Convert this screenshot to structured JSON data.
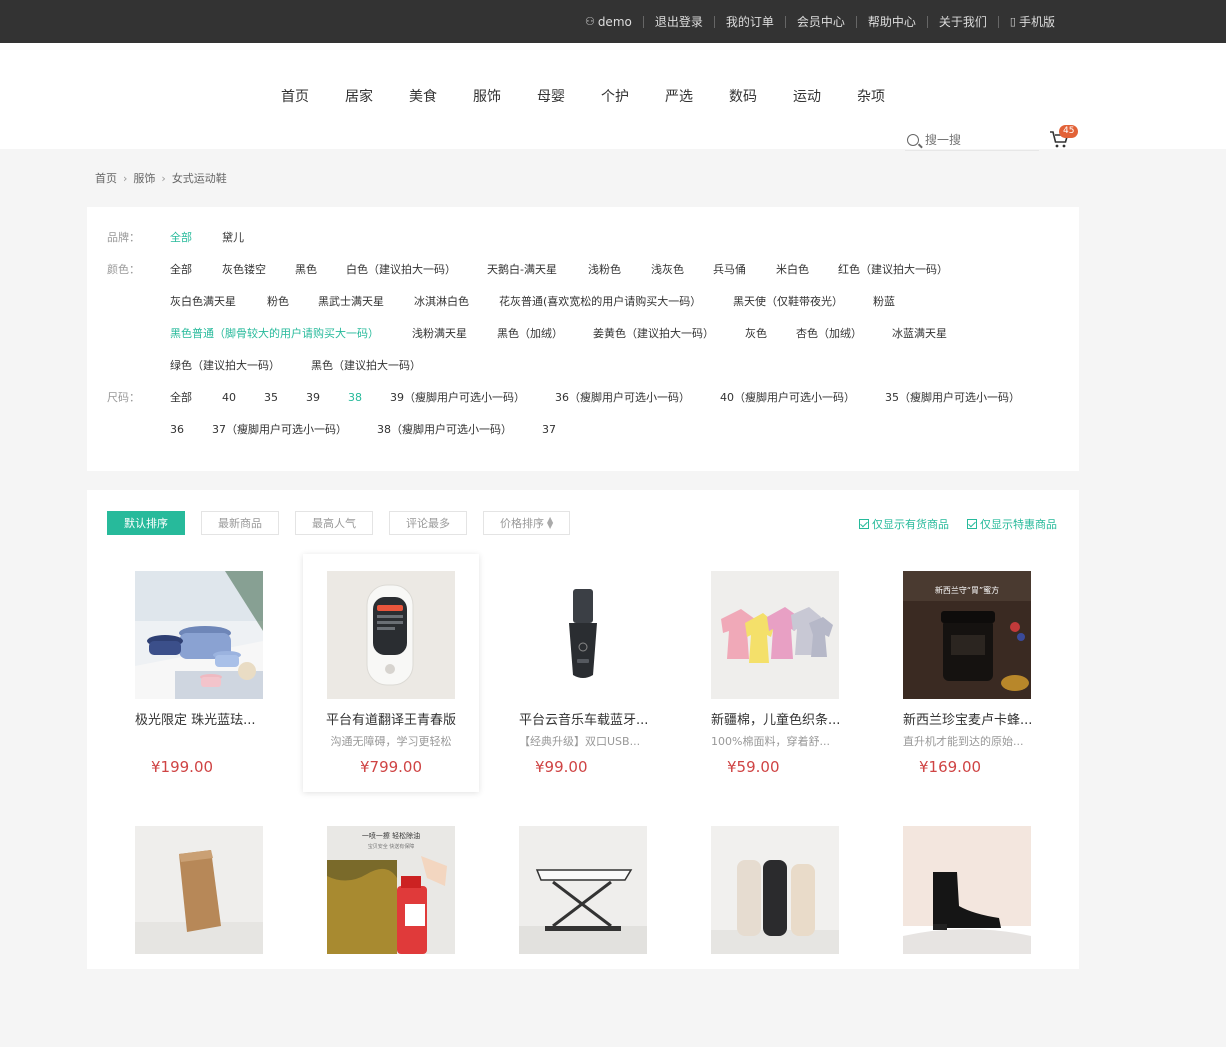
{
  "topbar": {
    "user": "demo",
    "logout": "退出登录",
    "orders": "我的订单",
    "member": "会员中心",
    "help": "帮助中心",
    "about": "关于我们",
    "mobile": "手机版"
  },
  "nav": [
    "首页",
    "居家",
    "美食",
    "服饰",
    "母婴",
    "个护",
    "严选",
    "数码",
    "运动",
    "杂项"
  ],
  "search": {
    "placeholder": "搜一搜"
  },
  "cart": {
    "count": "45"
  },
  "breadcrumb": [
    "首页",
    "服饰",
    "女式运动鞋"
  ],
  "filter": {
    "brand_label": "品牌：",
    "brand": [
      "全部",
      "黛儿"
    ],
    "color_label": "颜色：",
    "color_row1": [
      "全部",
      "灰色镂空",
      "黑色",
      "白色（建议拍大一码）",
      "天鹅白-满天星",
      "浅粉色",
      "浅灰色",
      "兵马俑",
      "米白色",
      "红色（建议拍大一码）"
    ],
    "color_row2": [
      "灰白色满天星",
      "粉色",
      "黑武士满天星",
      "冰淇淋白色",
      "花灰普通(喜欢宽松的用户请购买大一码）",
      "黑天使（仅鞋带夜光）",
      "粉蓝"
    ],
    "color_row3": [
      "黑色普通（脚骨较大的用户请购买大一码）",
      "浅粉满天星",
      "黑色（加绒）",
      "姜黄色（建议拍大一码）",
      "灰色",
      "杏色（加绒）",
      "冰蓝满天星"
    ],
    "color_row4": [
      "绿色（建议拍大一码）",
      "黑色（建议拍大一码）"
    ],
    "size_label": "尺码：",
    "size_row1": [
      "全部",
      "40",
      "35",
      "39",
      "38",
      "39（瘦脚用户可选小一码）",
      "36（瘦脚用户可选小一码）",
      "40（瘦脚用户可选小一码）",
      "35（瘦脚用户可选小一码）"
    ],
    "size_row2": [
      "36",
      "37（瘦脚用户可选小一码）",
      "38（瘦脚用户可选小一码）",
      "37"
    ]
  },
  "sort": {
    "default": "默认排序",
    "newest": "最新商品",
    "popular": "最高人气",
    "reviews": "评论最多",
    "price": "价格排序"
  },
  "checks": {
    "instock": "仅显示有货商品",
    "special": "仅显示特惠商品"
  },
  "products": [
    {
      "name": "极光限定 珠光蓝珐...",
      "desc": "",
      "price": "¥199.00"
    },
    {
      "name": "平台有道翻译王青春版",
      "desc": "沟通无障碍，学习更轻松",
      "price": "¥799.00"
    },
    {
      "name": "平台云音乐车载蓝牙...",
      "desc": "【经典升级】双口USB...",
      "price": "¥99.00"
    },
    {
      "name": "新疆棉，儿童色织条...",
      "desc": "100%棉面料，穿着舒...",
      "price": "¥59.00"
    },
    {
      "name": "新西兰珍宝麦卢卡蜂...",
      "desc": "直升机才能到达的原始...",
      "price": "¥169.00"
    }
  ],
  "product_banner": {
    "honey_top": "新西兰守“胃”蜜方",
    "cleaner_top": "一喷一擦 轻松除油",
    "cleaner_sub": "宝贝安全 快送有保障"
  },
  "colors": {
    "accent": "#27ba9b",
    "price": "#cf4444",
    "topbar": "#333333",
    "badge": "#e26237"
  }
}
